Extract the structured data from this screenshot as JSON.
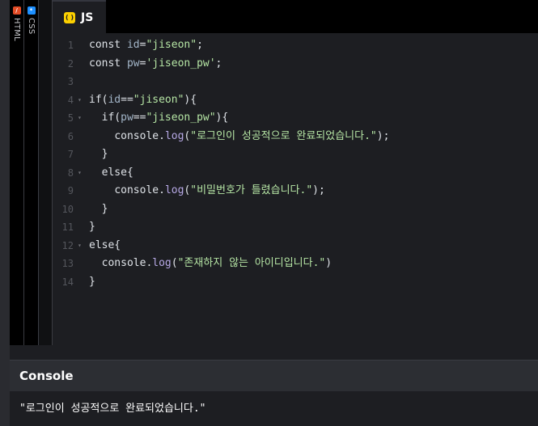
{
  "tabs": {
    "html": {
      "label": "HTML",
      "icon": "html-icon",
      "color": "#e34c26"
    },
    "css": {
      "label": "CSS",
      "icon": "css-icon",
      "color": "#1e90ff"
    },
    "js": {
      "label": "JS",
      "icon": "js-icon",
      "color": "#fcd000"
    }
  },
  "editor": {
    "lines": [
      {
        "num": "1",
        "fold": "",
        "indent": "",
        "tokens": [
          [
            "k",
            "const "
          ],
          [
            "v",
            "id"
          ],
          [
            "k",
            "="
          ],
          [
            "s",
            "\"jiseon\""
          ],
          [
            "k",
            ";"
          ]
        ]
      },
      {
        "num": "2",
        "fold": "",
        "indent": "",
        "tokens": [
          [
            "k",
            "const "
          ],
          [
            "v",
            "pw"
          ],
          [
            "k",
            "="
          ],
          [
            "s",
            "'jiseon_pw'"
          ],
          [
            "k",
            ";"
          ]
        ]
      },
      {
        "num": "3",
        "fold": "",
        "indent": "",
        "tokens": []
      },
      {
        "num": "4",
        "fold": "▾",
        "indent": "",
        "tokens": [
          [
            "k",
            "if("
          ],
          [
            "v",
            "id"
          ],
          [
            "k",
            "=="
          ],
          [
            "s",
            "\"jiseon\""
          ],
          [
            "k",
            "){"
          ]
        ]
      },
      {
        "num": "5",
        "fold": "▾",
        "indent": "  ",
        "tokens": [
          [
            "k",
            "if("
          ],
          [
            "v",
            "pw"
          ],
          [
            "k",
            "=="
          ],
          [
            "s",
            "\"jiseon_pw\""
          ],
          [
            "k",
            "){"
          ]
        ]
      },
      {
        "num": "6",
        "fold": "",
        "indent": "    ",
        "tokens": [
          [
            "k",
            "console."
          ],
          [
            "m",
            "log"
          ],
          [
            "k",
            "("
          ],
          [
            "s",
            "\"로그인이 성공적으로 완료되었습니다.\""
          ],
          [
            "k",
            ");"
          ]
        ]
      },
      {
        "num": "7",
        "fold": "",
        "indent": "  ",
        "tokens": [
          [
            "k",
            "}"
          ]
        ]
      },
      {
        "num": "8",
        "fold": "▾",
        "indent": "  ",
        "tokens": [
          [
            "k",
            "else{"
          ]
        ]
      },
      {
        "num": "9",
        "fold": "",
        "indent": "    ",
        "tokens": [
          [
            "k",
            "console."
          ],
          [
            "m",
            "log"
          ],
          [
            "k",
            "("
          ],
          [
            "s",
            "\"비밀번호가 틀렸습니다.\""
          ],
          [
            "k",
            ");"
          ]
        ]
      },
      {
        "num": "10",
        "fold": "",
        "indent": "  ",
        "tokens": [
          [
            "k",
            "}"
          ]
        ]
      },
      {
        "num": "11",
        "fold": "",
        "indent": "",
        "tokens": [
          [
            "k",
            "}"
          ]
        ]
      },
      {
        "num": "12",
        "fold": "▾",
        "indent": "",
        "tokens": [
          [
            "k",
            "else{"
          ]
        ]
      },
      {
        "num": "13",
        "fold": "",
        "indent": "  ",
        "tokens": [
          [
            "k",
            "console."
          ],
          [
            "m",
            "log"
          ],
          [
            "k",
            "("
          ],
          [
            "s",
            "\"존재하지 않는 아이디입니다.\""
          ],
          [
            "k",
            ")"
          ]
        ]
      },
      {
        "num": "14",
        "fold": "",
        "indent": "",
        "tokens": [
          [
            "k",
            "}"
          ]
        ]
      }
    ]
  },
  "console": {
    "title": "Console",
    "output": "\"로그인이 성공적으로 완료되었습니다.\""
  }
}
